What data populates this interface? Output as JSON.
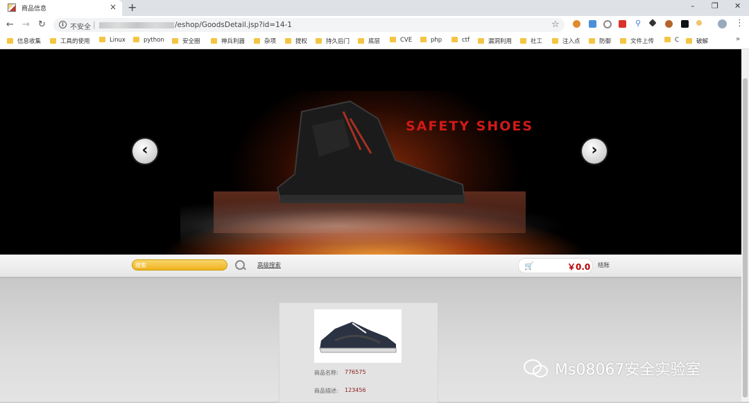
{
  "browser": {
    "tab_title": "商品信息",
    "new_tab": "+",
    "tab_close": "×",
    "address_security": "不安全",
    "address_sep": "|",
    "url": "/eshop/GoodsDetail.jsp?id=14-1",
    "window_controls": [
      "–",
      "❐",
      "✕"
    ]
  },
  "bookmarks": [
    "信息收集",
    "工具的使用",
    "Linux",
    "python",
    "安全圈",
    "神兵利器",
    "杂项",
    "提权",
    "持久后门",
    "底层",
    "CVE",
    "php",
    "ctf",
    "漏洞利用",
    "社工",
    "注入点",
    "防御",
    "文件上传",
    "C",
    "破解"
  ],
  "bookmarks_more": "»",
  "banner": {
    "headline": "SAFETY SHOES",
    "prev_symbol": "‹",
    "next_symbol": "›"
  },
  "search": {
    "placeholder": "搜索",
    "advanced_label": "高级搜索",
    "cart_amount": "￥0.0",
    "checkout_label": "结账"
  },
  "product": {
    "name_label": "商品名称:",
    "name_value": "776575",
    "desc_label": "商品描述:",
    "desc_value": "123456"
  },
  "watermark": "Ms08067安全实验室",
  "colors": {
    "accent": "#efb21e",
    "price": "#b80000",
    "headline": "#d11a17"
  }
}
